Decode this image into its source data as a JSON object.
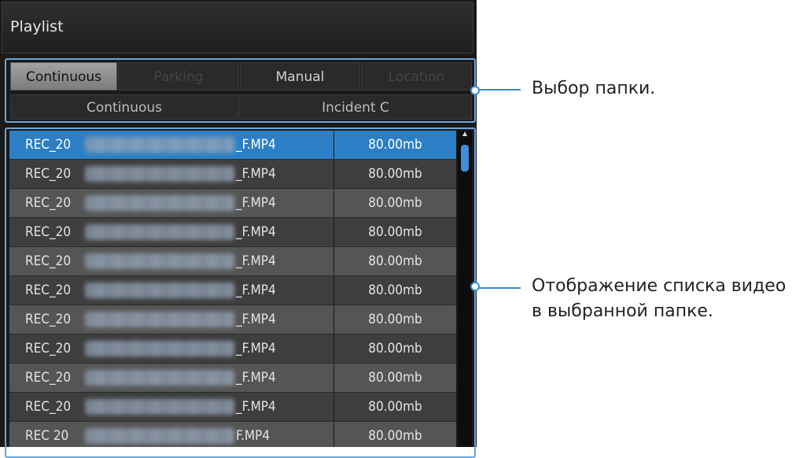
{
  "window": {
    "title": "Playlist"
  },
  "folder_tabs": {
    "top": [
      {
        "label": "Continuous",
        "state": "active"
      },
      {
        "label": "Parking",
        "state": "disabled"
      },
      {
        "label": "Manual",
        "state": "normal"
      },
      {
        "label": "Location",
        "state": "disabled"
      }
    ],
    "bottom": [
      {
        "label": "Continuous"
      },
      {
        "label": "Incident C"
      }
    ]
  },
  "file_list": {
    "rows": [
      {
        "prefix": "REC_20",
        "suffix": "_F.MP4",
        "size": "80.00mb",
        "selected": true
      },
      {
        "prefix": "REC_20",
        "suffix": "_F.MP4",
        "size": "80.00mb"
      },
      {
        "prefix": "REC_20",
        "suffix": "_F.MP4",
        "size": "80.00mb"
      },
      {
        "prefix": "REC_20",
        "suffix": "_F.MP4",
        "size": "80.00mb"
      },
      {
        "prefix": "REC_20",
        "suffix": "_F.MP4",
        "size": "80.00mb"
      },
      {
        "prefix": "REC_20",
        "suffix": "_F.MP4",
        "size": "80.00mb"
      },
      {
        "prefix": "REC_20",
        "suffix": "_F.MP4",
        "size": "80.00mb"
      },
      {
        "prefix": "REC_20",
        "suffix": "_F.MP4",
        "size": "80.00mb"
      },
      {
        "prefix": "REC_20",
        "suffix": "_F.MP4",
        "size": "80.00mb"
      },
      {
        "prefix": "REC_20",
        "suffix": "_F.MP4",
        "size": "80.00mb"
      },
      {
        "prefix": "REC 20",
        "suffix": "F.MP4",
        "size": "80.00mb"
      }
    ]
  },
  "callouts": {
    "folder_select": "Выбор папки.",
    "video_list_line1": "Отображение списка видео",
    "video_list_line2": "в выбранной папке."
  },
  "colors": {
    "accent": "#3b8ad1",
    "selected_row": "#2c7fc4",
    "panel_bg": "#1a1a1a"
  },
  "icons": {
    "scroll_up": "triangle-up",
    "scroll_thumb": "scroll-thumb"
  }
}
